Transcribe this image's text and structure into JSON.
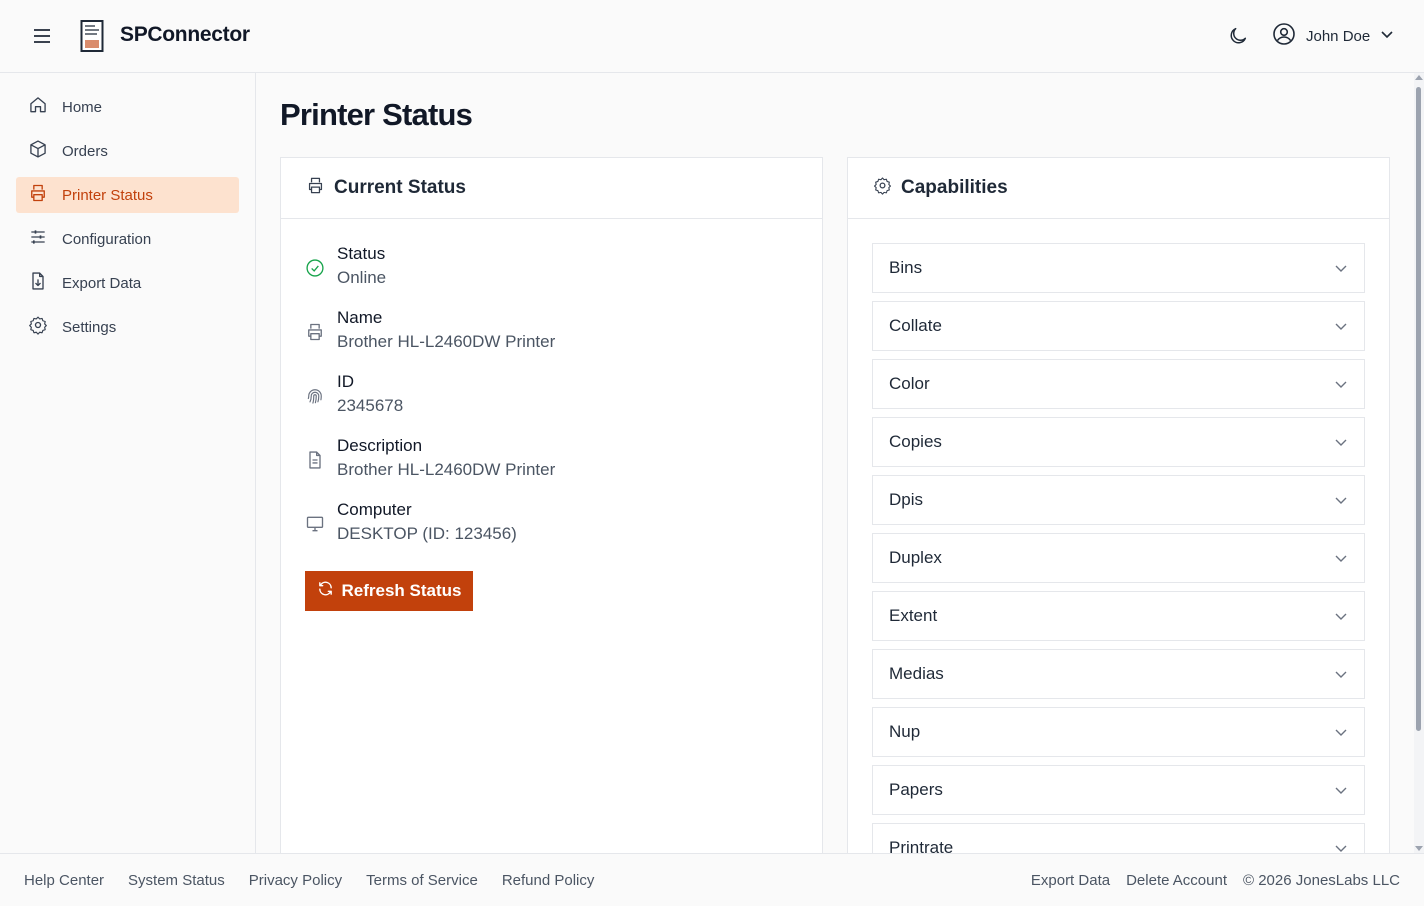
{
  "header": {
    "app_title": "SPConnector",
    "user_name": "John Doe",
    "menu_icon": "menu-icon",
    "theme_icon": "moon-icon",
    "user_icon": "user-circle-icon"
  },
  "sidebar": {
    "items": [
      {
        "label": "Home",
        "icon": "home-icon"
      },
      {
        "label": "Orders",
        "icon": "box-icon"
      },
      {
        "label": "Printer Status",
        "icon": "printer-icon",
        "active": true
      },
      {
        "label": "Configuration",
        "icon": "sliders-icon"
      },
      {
        "label": "Export Data",
        "icon": "file-download-icon"
      },
      {
        "label": "Settings",
        "icon": "gear-icon"
      }
    ]
  },
  "main": {
    "page_title": "Printer Status",
    "status_card": {
      "title": "Current Status",
      "fields": [
        {
          "label": "Status",
          "value": "Online",
          "icon": "check-circle-icon"
        },
        {
          "label": "Name",
          "value": "Brother HL-L2460DW Printer",
          "icon": "printer-icon"
        },
        {
          "label": "ID",
          "value": "2345678",
          "icon": "fingerprint-icon"
        },
        {
          "label": "Description",
          "value": "Brother HL-L2460DW Printer",
          "icon": "file-text-icon"
        },
        {
          "label": "Computer",
          "value": "DESKTOP (ID: 123456)",
          "icon": "monitor-icon"
        }
      ],
      "refresh_label": "Refresh Status"
    },
    "capabilities_card": {
      "title": "Capabilities",
      "items": [
        "Bins",
        "Collate",
        "Color",
        "Copies",
        "Dpis",
        "Duplex",
        "Extent",
        "Medias",
        "Nup",
        "Papers",
        "Printrate"
      ]
    }
  },
  "footer": {
    "left_links": [
      "Help Center",
      "System Status",
      "Privacy Policy",
      "Terms of Service",
      "Refund Policy"
    ],
    "right_links": [
      "Export Data",
      "Delete Account"
    ],
    "copyright": "© 2026 JonesLabs LLC"
  },
  "colors": {
    "accent": "#c2410c",
    "active_bg": "#fde2cf",
    "online": "#16a34a"
  }
}
